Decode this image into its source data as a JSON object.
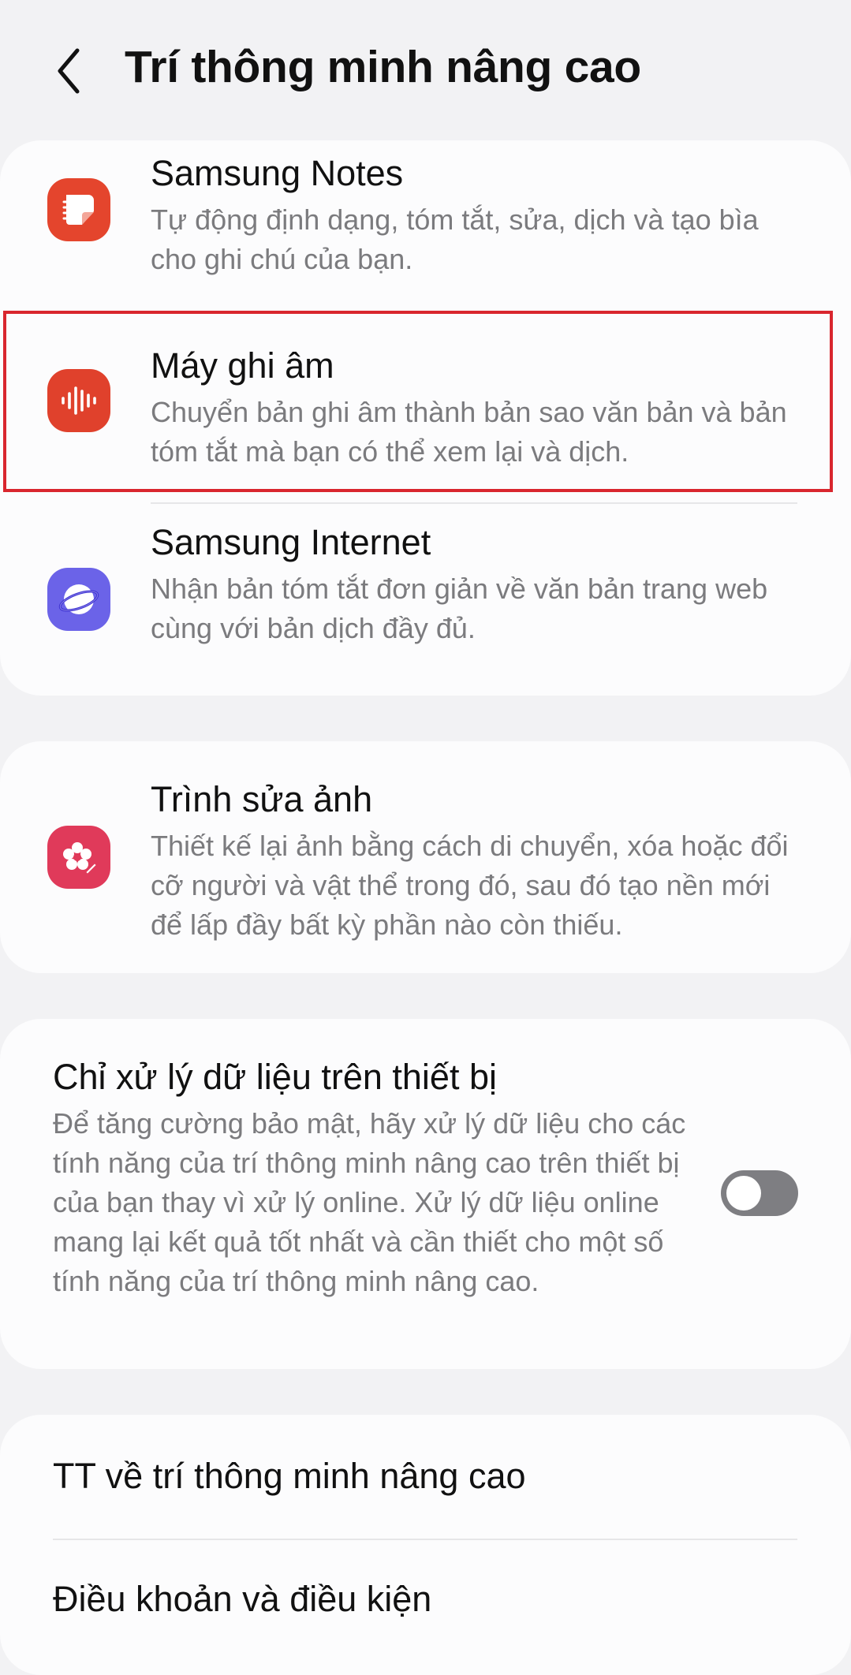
{
  "header": {
    "title": "Trí thông minh nâng cao"
  },
  "apps": [
    {
      "title": "Samsung Notes",
      "description": "Tự động định dạng, tóm tắt, sửa, dịch và tạo bìa cho ghi chú của bạn.",
      "icon": "notes-icon",
      "color": "#e4452d"
    },
    {
      "title": "Máy ghi âm",
      "description": "Chuyển bản ghi âm thành bản sao văn bản và bản tóm tắt mà bạn có thể xem lại và dịch.",
      "icon": "voice-recorder-icon",
      "color": "#e0412c"
    },
    {
      "title": "Samsung Internet",
      "description": "Nhận bản tóm tắt đơn giản về văn bản trang web cùng với bản dịch đầy đủ.",
      "icon": "internet-icon",
      "color": "#6b63e8"
    }
  ],
  "photo_editor": {
    "title": "Trình sửa ảnh",
    "description": "Thiết kế lại ảnh bằng cách di chuyển, xóa hoặc đổi cỡ người và vật thể trong đó, sau đó tạo nền mới để lấp đầy bất kỳ phần nào còn thiếu.",
    "icon": "gallery-icon",
    "color": "#e03a5a"
  },
  "on_device": {
    "title": "Chỉ xử lý dữ liệu trên thiết bị",
    "description": "Để tăng cường bảo mật, hãy xử lý dữ liệu cho các tính năng của trí thông minh nâng cao trên thiết bị của bạn thay vì xử lý online. Xử lý dữ liệu online mang lại kết quả tốt nhất và cần thiết cho một số tính năng của trí thông minh nâng cao.",
    "toggle_on": false
  },
  "links": {
    "about": "TT về trí thông minh nâng cao",
    "terms": "Điều khoản và điều kiện"
  }
}
